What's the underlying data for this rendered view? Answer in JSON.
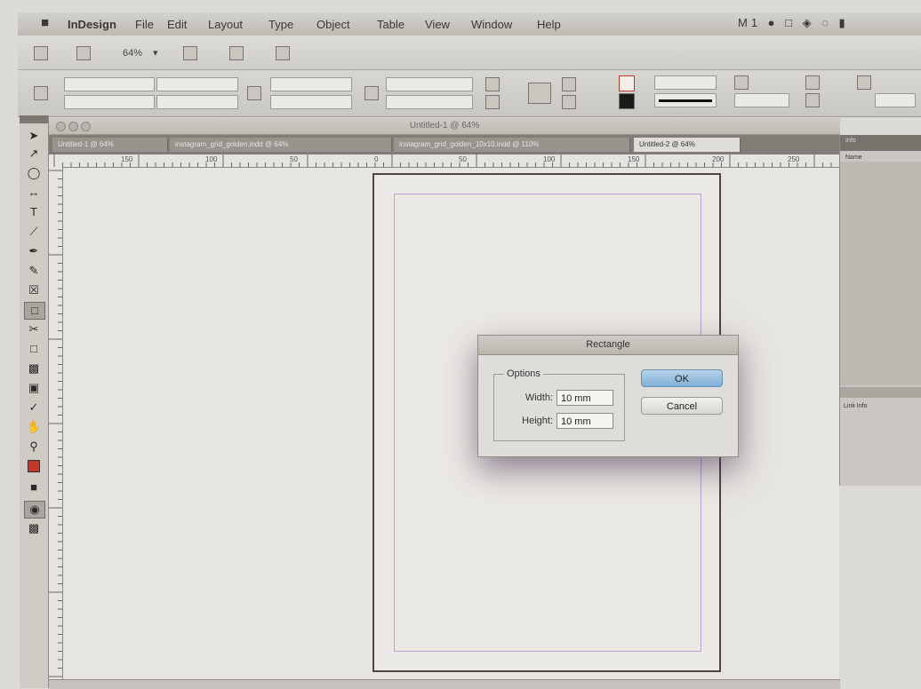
{
  "menubar": {
    "apple_icon": "apple-logo-icon",
    "items": [
      "InDesign",
      "File",
      "Edit",
      "Layout",
      "Type",
      "Object",
      "Table",
      "View",
      "Window",
      "Help"
    ],
    "status": "M1"
  },
  "toolbar": {
    "zoom": "64%"
  },
  "window": {
    "title": "Untitled-1 @ 64%"
  },
  "tabs": [
    {
      "label": "Untitled-1 @ 64%"
    },
    {
      "label": "instagram_grid_golden.indd @ 64%"
    },
    {
      "label": "instagram_grid_golden_10x10.indd @ 110%"
    },
    {
      "label": "Untitled-2 @ 64%"
    }
  ],
  "ruler": {
    "h_ticks": [
      "150",
      "100",
      "50",
      "0",
      "50",
      "100",
      "150",
      "200",
      "250"
    ]
  },
  "right_panel": {
    "tab": "Info",
    "sub": "Name",
    "list_item": "Link Info"
  },
  "dialog": {
    "title": "Rectangle",
    "options_label": "Options",
    "width_label": "Width:",
    "width_value": "10 mm",
    "height_label": "Height:",
    "height_value": "10 mm",
    "ok_label": "OK",
    "cancel_label": "Cancel"
  },
  "colors": {
    "margin_guide": "#b9a3d2",
    "ok_button": "#7fb0d8"
  }
}
